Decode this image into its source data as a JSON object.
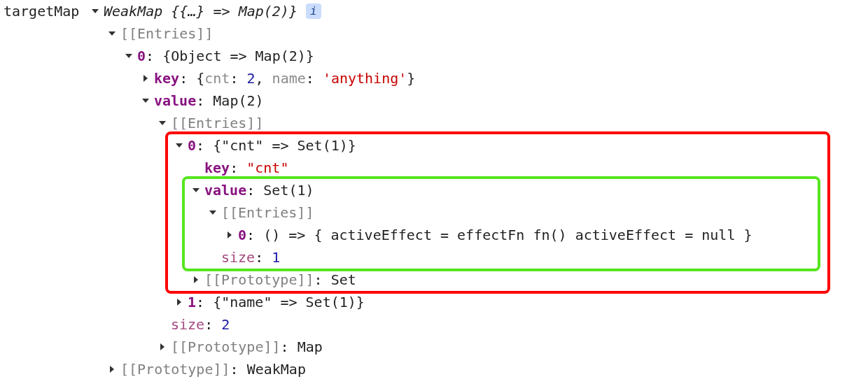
{
  "variable": {
    "name": "targetMap"
  },
  "tree": {
    "expanded": true,
    "tokens": [
      {
        "text": "WeakMap {{…} => Map(2)}",
        "kind": "italic"
      }
    ],
    "badge": "i",
    "children": [
      {
        "expanded": true,
        "tokens": [
          {
            "text": "[[Entries]]",
            "kind": "internal"
          }
        ],
        "children": [
          {
            "expanded": true,
            "tokens": [
              {
                "text": "0",
                "kind": "property"
              },
              {
                "text": ": {Object => Map(2)}",
                "kind": "plain"
              }
            ],
            "children": [
              {
                "expanded": false,
                "tokens": [
                  {
                    "text": "key",
                    "kind": "property"
                  },
                  {
                    "text": ": {",
                    "kind": "plain"
                  },
                  {
                    "text": "cnt",
                    "kind": "dim"
                  },
                  {
                    "text": ": ",
                    "kind": "plain"
                  },
                  {
                    "text": "2",
                    "kind": "number"
                  },
                  {
                    "text": ", ",
                    "kind": "plain"
                  },
                  {
                    "text": "name",
                    "kind": "dim"
                  },
                  {
                    "text": ": ",
                    "kind": "plain"
                  },
                  {
                    "text": "'anything'",
                    "kind": "string"
                  },
                  {
                    "text": "}",
                    "kind": "plain"
                  }
                ]
              },
              {
                "expanded": true,
                "tokens": [
                  {
                    "text": "value",
                    "kind": "property"
                  },
                  {
                    "text": ": Map(2)",
                    "kind": "plain"
                  }
                ],
                "children": [
                  {
                    "expanded": true,
                    "tokens": [
                      {
                        "text": "[[Entries]]",
                        "kind": "internal"
                      }
                    ],
                    "children": [
                      {
                        "expanded": true,
                        "color": "#ff0000",
                        "tokens": [
                          {
                            "text": "0",
                            "kind": "property"
                          },
                          {
                            "text": ": {\"cnt\" => Set(1)}",
                            "kind": "plain"
                          }
                        ],
                        "children": [
                          {
                            "tokens": [
                              {
                                "text": "key",
                                "kind": "property"
                              },
                              {
                                "text": ": ",
                                "kind": "plain"
                              },
                              {
                                "text": "\"cnt\"",
                                "kind": "string"
                              }
                            ]
                          },
                          {
                            "expanded": true,
                            "color": "#55e61e",
                            "tokens": [
                              {
                                "text": "value",
                                "kind": "property"
                              },
                              {
                                "text": ": Set(1)",
                                "kind": "plain"
                              }
                            ],
                            "children": [
                              {
                                "expanded": true,
                                "tokens": [
                                  {
                                    "text": "[[Entries]]",
                                    "kind": "internal"
                                  }
                                ],
                                "children": [
                                  {
                                    "expanded": false,
                                    "tokens": [
                                      {
                                        "text": "0",
                                        "kind": "property"
                                      },
                                      {
                                        "text": ": () => { activeEffect = effectFn fn() activeEffect = null }",
                                        "kind": "plain"
                                      }
                                    ]
                                  }
                                ]
                              },
                              {
                                "tokens": [
                                  {
                                    "text": "size",
                                    "kind": "meta"
                                  },
                                  {
                                    "text": ": ",
                                    "kind": "plain"
                                  },
                                  {
                                    "text": "1",
                                    "kind": "number"
                                  }
                                ]
                              }
                            ]
                          },
                          {
                            "expanded": false,
                            "tokens": [
                              {
                                "text": "[[Prototype]]",
                                "kind": "internal"
                              },
                              {
                                "text": ": Set",
                                "kind": "plain"
                              }
                            ]
                          }
                        ]
                      },
                      {
                        "expanded": false,
                        "tokens": [
                          {
                            "text": "1",
                            "kind": "property"
                          },
                          {
                            "text": ": {\"name\" => Set(1)}",
                            "kind": "plain"
                          }
                        ]
                      }
                    ]
                  },
                  {
                    "tokens": [
                      {
                        "text": "size",
                        "kind": "meta"
                      },
                      {
                        "text": ": ",
                        "kind": "plain"
                      },
                      {
                        "text": "2",
                        "kind": "number"
                      }
                    ]
                  },
                  {
                    "expanded": false,
                    "tokens": [
                      {
                        "text": "[[Prototype]]",
                        "kind": "internal"
                      },
                      {
                        "text": ": Map",
                        "kind": "plain"
                      }
                    ]
                  }
                ]
              }
            ]
          }
        ]
      },
      {
        "expanded": false,
        "tokens": [
          {
            "text": "[[Prototype]]",
            "kind": "internal"
          },
          {
            "text": ": WeakMap",
            "kind": "plain"
          }
        ]
      }
    ]
  }
}
